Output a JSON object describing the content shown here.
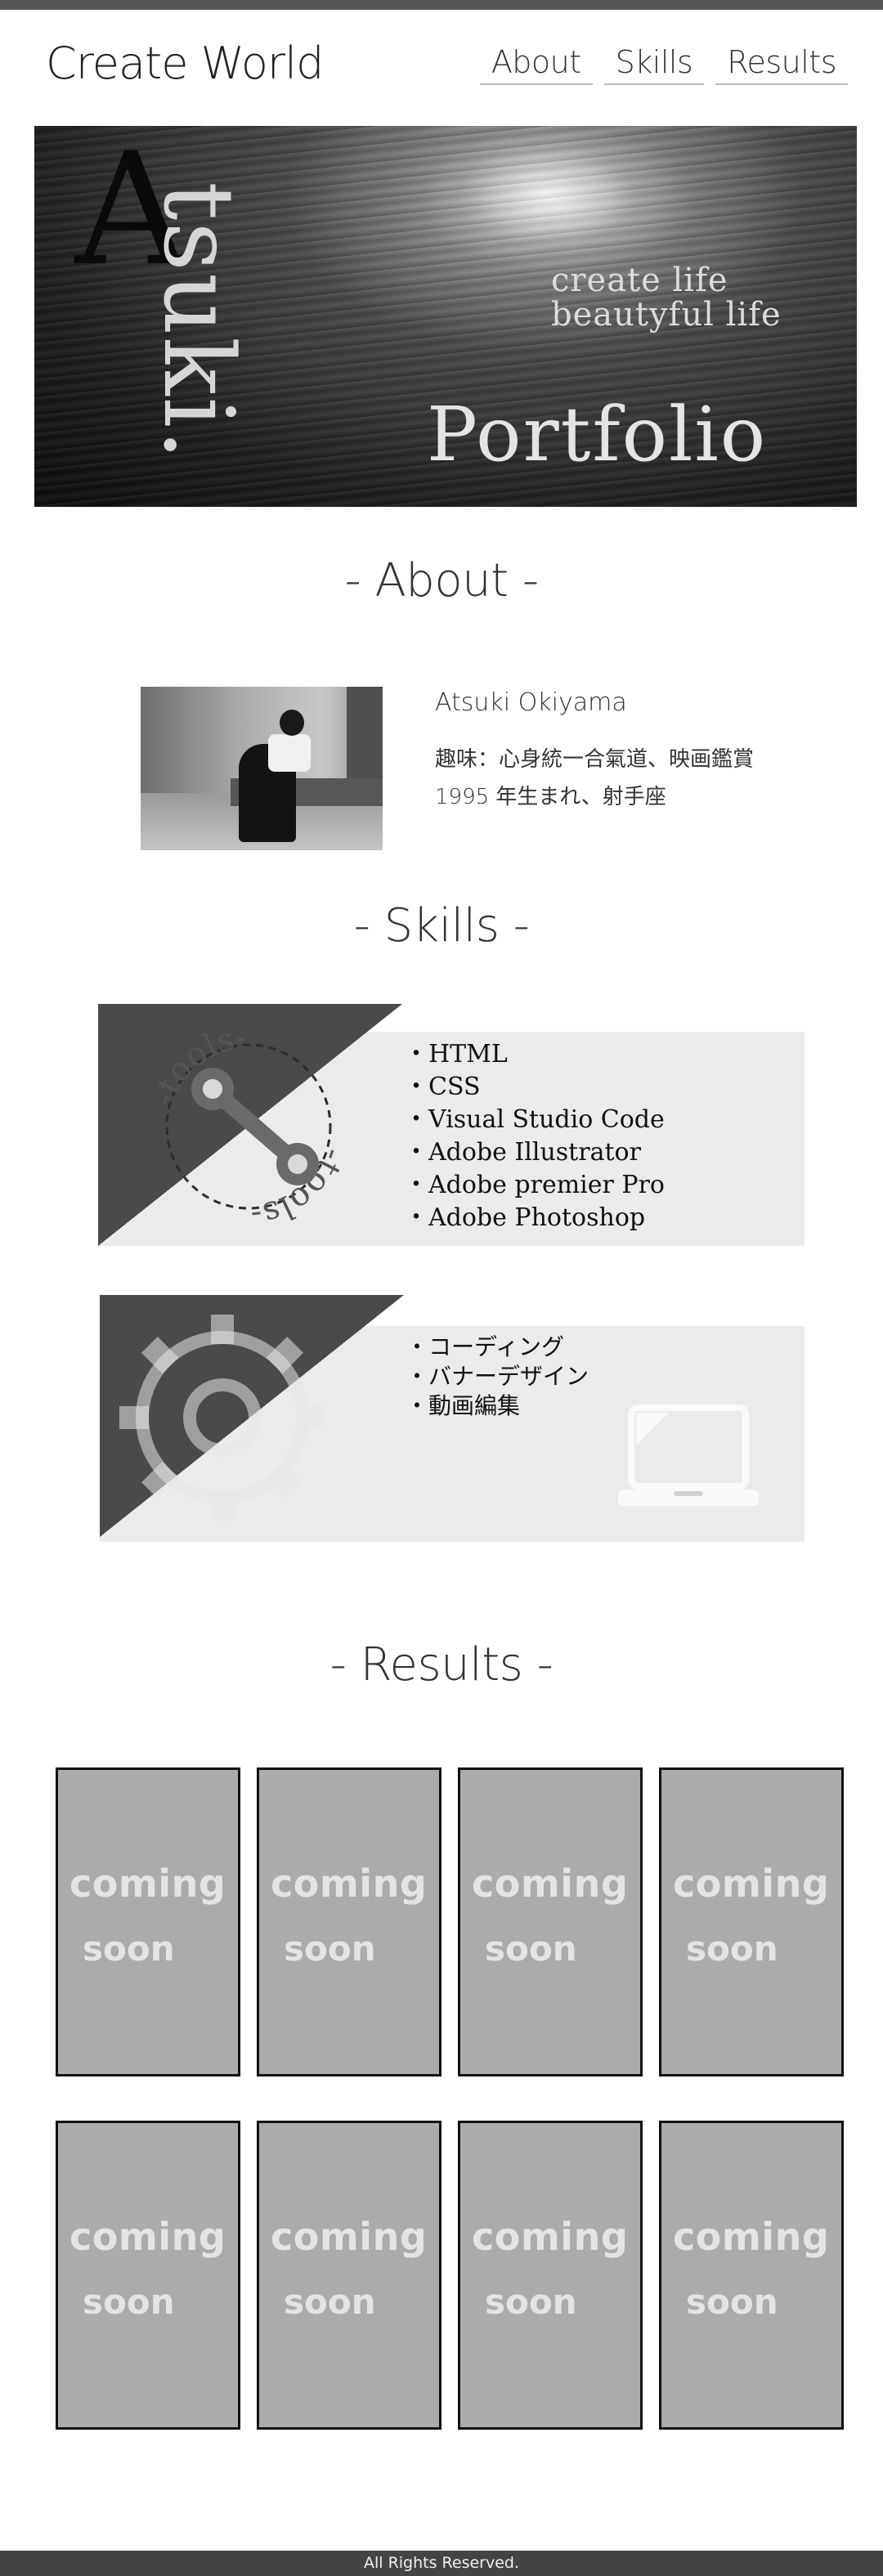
{
  "header": {
    "logo": "Create World",
    "nav": [
      "About",
      "Skills",
      "Results"
    ]
  },
  "hero": {
    "initial": "A",
    "vertical_word": "tsuki.",
    "tagline_1": "create life",
    "tagline_2": "beautyful life",
    "title": "Portfolio"
  },
  "about": {
    "heading": "- About -",
    "name": "Atsuki Okiyama",
    "hobby": "趣味：心身統一合氣道、映画鑑賞",
    "birth": "1995 年生まれ、射手座"
  },
  "skills": {
    "heading": "- Skills -",
    "tools_label": "-tools-",
    "tools": [
      "・HTML",
      "・CSS",
      "・Visual Studio Code",
      "・Adobe Illustrator",
      "・Adobe premier Pro",
      "・Adobe Photoshop"
    ],
    "abilities": [
      "・コーディング",
      "・バナーデザイン",
      "・動画編集"
    ],
    "colors": {
      "dark": "#4a4a4a",
      "panel": "#ebebeb"
    }
  },
  "results": {
    "heading": "- Results -",
    "items": [
      {
        "line1": "coming",
        "line2": "soon"
      },
      {
        "line1": "coming",
        "line2": "soon"
      },
      {
        "line1": "coming",
        "line2": "soon"
      },
      {
        "line1": "coming",
        "line2": "soon"
      },
      {
        "line1": "coming",
        "line2": "soon"
      },
      {
        "line1": "coming",
        "line2": "soon"
      },
      {
        "line1": "coming",
        "line2": "soon"
      },
      {
        "line1": "coming",
        "line2": "soon"
      }
    ]
  },
  "footer": {
    "text": "All Rights Reserved."
  }
}
